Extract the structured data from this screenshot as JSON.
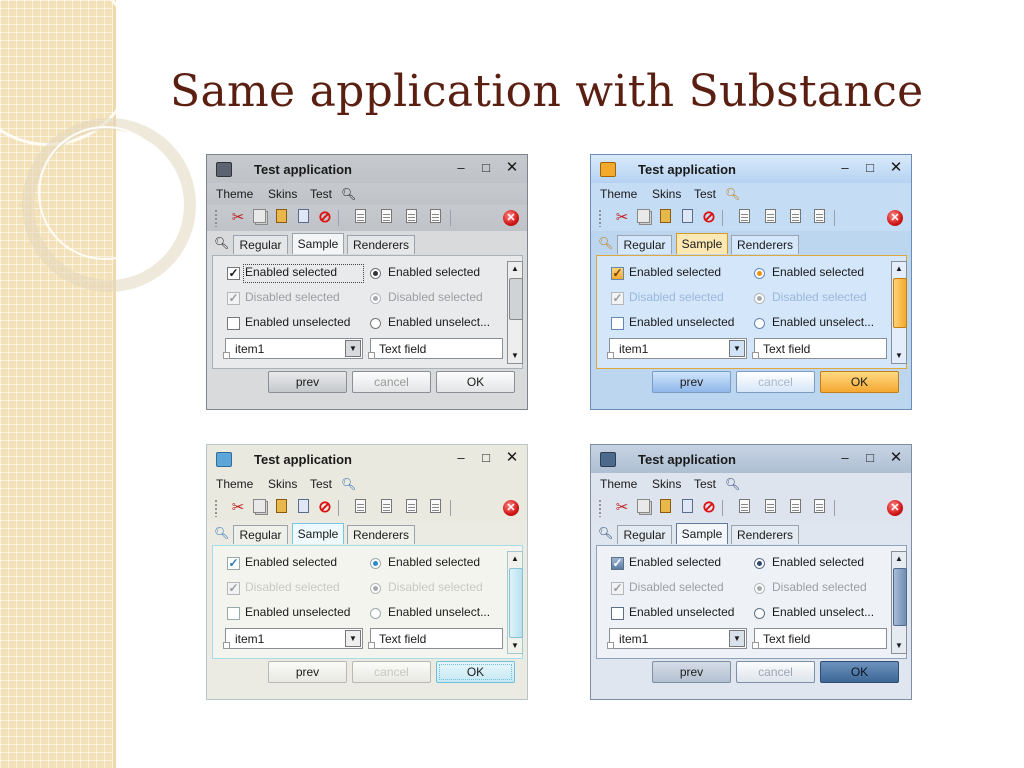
{
  "slide": {
    "title": "Same application with Substance"
  },
  "windows": [
    {
      "theme": "business-gray",
      "title": "Test application",
      "menu": [
        "Theme",
        "Skins",
        "Test"
      ],
      "tabs": [
        "Regular",
        "Sample",
        "Renderers"
      ],
      "selected_tab": "Sample",
      "checkboxes": [
        {
          "label": "Enabled selected",
          "checked": true,
          "enabled": true
        },
        {
          "label": "Disabled selected",
          "checked": true,
          "enabled": false
        },
        {
          "label": "Enabled unselected",
          "checked": false,
          "enabled": true
        }
      ],
      "radios": [
        {
          "label": "Enabled selected",
          "selected": true,
          "enabled": true
        },
        {
          "label": "Disabled selected",
          "selected": true,
          "enabled": false
        },
        {
          "label": "Enabled unselect...",
          "selected": false,
          "enabled": true
        }
      ],
      "combo_value": "item1",
      "text_field": "Text field",
      "buttons": [
        "prev",
        "cancel",
        "OK"
      ]
    },
    {
      "theme": "office-blue",
      "title": "Test application",
      "menu": [
        "Theme",
        "Skins",
        "Test"
      ],
      "tabs": [
        "Regular",
        "Sample",
        "Renderers"
      ],
      "selected_tab": "Sample",
      "checkboxes": [
        {
          "label": "Enabled selected",
          "checked": true,
          "enabled": true
        },
        {
          "label": "Disabled selected",
          "checked": true,
          "enabled": false
        },
        {
          "label": "Enabled unselected",
          "checked": false,
          "enabled": true
        }
      ],
      "radios": [
        {
          "label": "Enabled selected",
          "selected": true,
          "enabled": true
        },
        {
          "label": "Disabled selected",
          "selected": true,
          "enabled": false
        },
        {
          "label": "Enabled unselect...",
          "selected": false,
          "enabled": true
        }
      ],
      "combo_value": "item1",
      "text_field": "Text field",
      "buttons": [
        "prev",
        "cancel",
        "OK"
      ]
    },
    {
      "theme": "creme",
      "title": "Test application",
      "menu": [
        "Theme",
        "Skins",
        "Test"
      ],
      "tabs": [
        "Regular",
        "Sample",
        "Renderers"
      ],
      "selected_tab": "Sample",
      "checkboxes": [
        {
          "label": "Enabled selected",
          "checked": true,
          "enabled": true
        },
        {
          "label": "Disabled selected",
          "checked": true,
          "enabled": false
        },
        {
          "label": "Enabled unselected",
          "checked": false,
          "enabled": true
        }
      ],
      "radios": [
        {
          "label": "Enabled selected",
          "selected": true,
          "enabled": true
        },
        {
          "label": "Disabled selected",
          "selected": true,
          "enabled": false
        },
        {
          "label": "Enabled unselect...",
          "selected": false,
          "enabled": true
        }
      ],
      "combo_value": "item1",
      "text_field": "Text field",
      "buttons": [
        "prev",
        "cancel",
        "OK"
      ]
    },
    {
      "theme": "steel-blue",
      "title": "Test application",
      "menu": [
        "Theme",
        "Skins",
        "Test"
      ],
      "tabs": [
        "Regular",
        "Sample",
        "Renderers"
      ],
      "selected_tab": "Sample",
      "checkboxes": [
        {
          "label": "Enabled selected",
          "checked": true,
          "enabled": true
        },
        {
          "label": "Disabled selected",
          "checked": true,
          "enabled": false
        },
        {
          "label": "Enabled unselected",
          "checked": false,
          "enabled": true
        }
      ],
      "radios": [
        {
          "label": "Enabled selected",
          "selected": true,
          "enabled": true
        },
        {
          "label": "Disabled selected",
          "selected": true,
          "enabled": false
        },
        {
          "label": "Enabled unselect...",
          "selected": false,
          "enabled": true
        }
      ],
      "combo_value": "item1",
      "text_field": "Text field",
      "buttons": [
        "prev",
        "cancel",
        "OK"
      ]
    }
  ],
  "icons": {
    "window_controls": [
      "minimize-icon",
      "maximize-icon",
      "close-icon"
    ],
    "toolbar": [
      "cut-icon",
      "copy-icon",
      "paste-icon",
      "document-icon",
      "stop-icon",
      "align-icon",
      "align-icon",
      "align-icon",
      "align-icon",
      "close-circle-icon"
    ],
    "search": "search-icon"
  },
  "colors": {
    "title": "#5b1f12",
    "sideband": "#f3e2b9",
    "office_accent": "#f3a92c",
    "creme_accent": "#7ac7dd",
    "steel_accent": "#4d6a8c"
  }
}
